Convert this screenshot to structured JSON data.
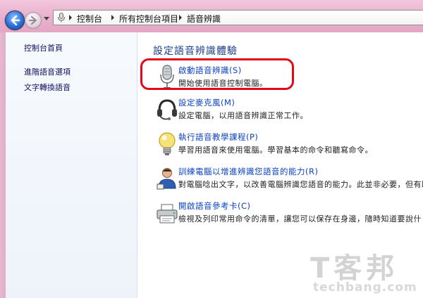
{
  "address": {
    "crumbs": [
      "控制台",
      "所有控制台項目",
      "語音辨識"
    ]
  },
  "leftpane": {
    "links": [
      "控制台首頁",
      "進階語音選項",
      "文字轉換語音"
    ]
  },
  "main": {
    "heading": "設定語音辨識體驗",
    "items": [
      {
        "title": "啟動語音辨識(S)",
        "desc": "開始使用語音控制電腦。",
        "icon": "microphone-icon"
      },
      {
        "title": "設定麥克風(M)",
        "desc": "設定電腦，以用語音辨識正常工作。",
        "icon": "headset-icon"
      },
      {
        "title": "執行語音教學課程(P)",
        "desc": "學習用語音來使用電腦。學習基本的命令和聽寫命令。",
        "icon": "lightbulb-icon"
      },
      {
        "title": "訓練電腦以增進辨識您語音的能力(R)",
        "desc": "對電腦唸出文字，以改善電腦辨識您語音的能力。此並非必要，但有助",
        "icon": "user-icon"
      },
      {
        "title": "開啟語音參考卡(C)",
        "desc": "檢視及列印常用命令的清單，讓您可以保存在身邊，隨時知道要說什",
        "icon": "printer-icon"
      }
    ]
  },
  "watermark": {
    "logo": "T客邦",
    "sub": "techbang.com"
  },
  "colors": {
    "link": "#0c43c2",
    "heading": "#1a3d86",
    "highlight": "#e2091b",
    "chrome": "#e9b0cb"
  }
}
